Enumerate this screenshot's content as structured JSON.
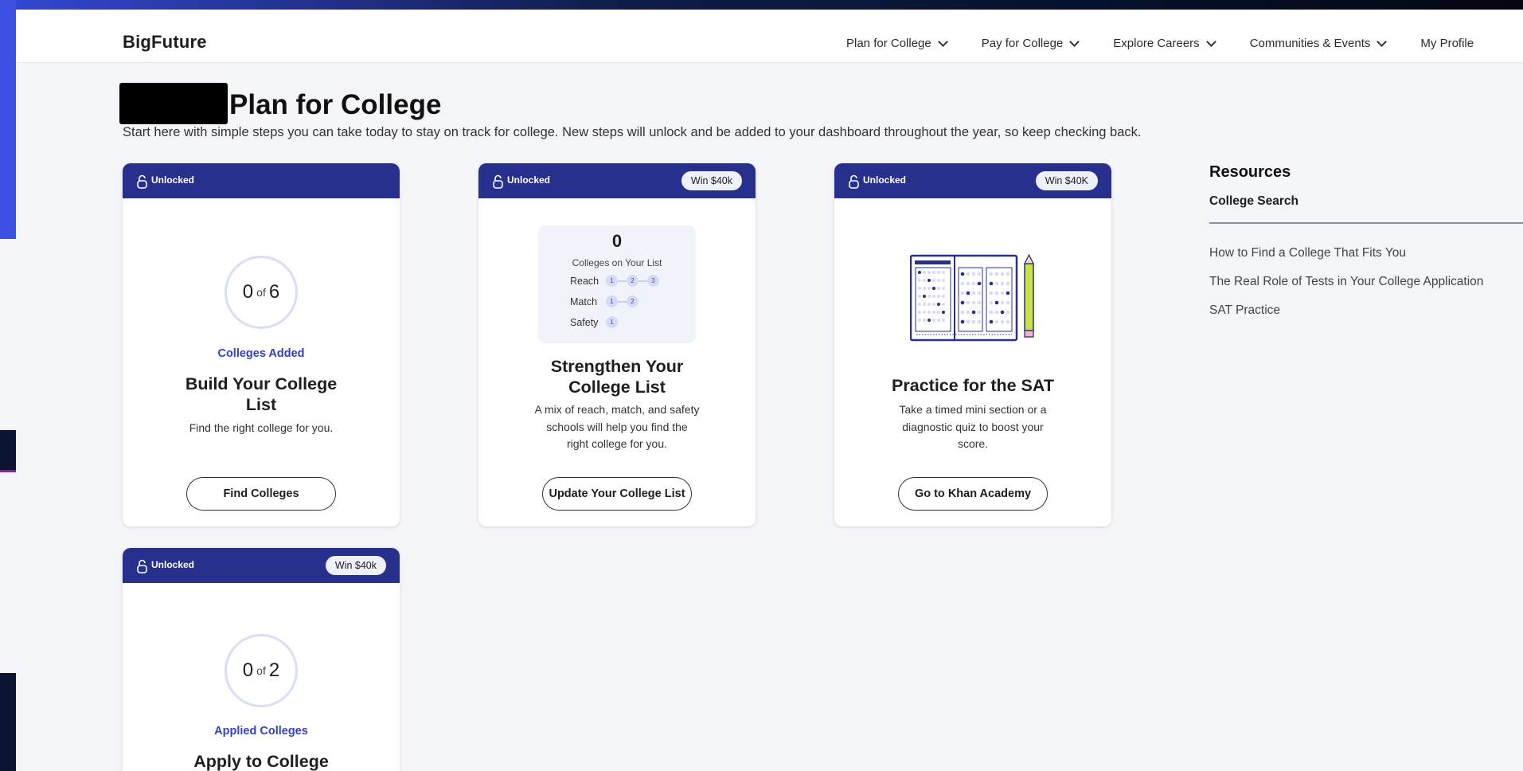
{
  "header": {
    "logo": "BigFuture",
    "nav": [
      {
        "label": "Plan for College",
        "has_dropdown": true
      },
      {
        "label": "Pay for College",
        "has_dropdown": true
      },
      {
        "label": "Explore Careers",
        "has_dropdown": true
      },
      {
        "label": "Communities & Events",
        "has_dropdown": true
      },
      {
        "label": "My Profile",
        "has_dropdown": false
      }
    ]
  },
  "page": {
    "title": "Plan for College",
    "subtitle": "Start here with simple steps you can take today to stay on track for college. New steps will unlock and be added to your dashboard throughout the year, so keep checking back."
  },
  "cards": [
    {
      "status": "Unlocked",
      "badge": "",
      "progress_current": "0",
      "progress_of": "of",
      "progress_total": "6",
      "progress_label": "Colleges Added",
      "title": "Build Your College List",
      "description": "Find the right college for you.",
      "button": "Find Colleges"
    },
    {
      "status": "Unlocked",
      "badge": "Win $40k",
      "list_count": "0",
      "list_label": "Colleges on Your List",
      "rows": [
        {
          "name": "Reach",
          "dots": [
            "1",
            "2",
            "3"
          ]
        },
        {
          "name": "Match",
          "dots": [
            "1",
            "2"
          ]
        },
        {
          "name": "Safety",
          "dots": [
            "1"
          ]
        }
      ],
      "title": "Strengthen Your College List",
      "description": "A mix of reach, match, and safety schools will help you find the right college for you.",
      "button": "Update Your College List"
    },
    {
      "status": "Unlocked",
      "badge": "Win $40K",
      "title": "Practice for the SAT",
      "description": "Take a timed mini section or a diagnostic quiz to boost your score.",
      "button": "Go to Khan Academy"
    },
    {
      "status": "Unlocked",
      "badge": "Win $40k",
      "progress_current": "0",
      "progress_of": "of",
      "progress_total": "2",
      "progress_label": "Applied Colleges",
      "title": "Apply to College"
    }
  ],
  "resources": {
    "title": "Resources",
    "tab": "College Search",
    "links": [
      "How to Find a College That Fits You",
      "The Real Role of Tests in Your College Application",
      "SAT Practice"
    ]
  },
  "colors": {
    "card_header": "#27308c",
    "accent_text": "#3340c4",
    "page_bg": "#f4f5f9"
  }
}
